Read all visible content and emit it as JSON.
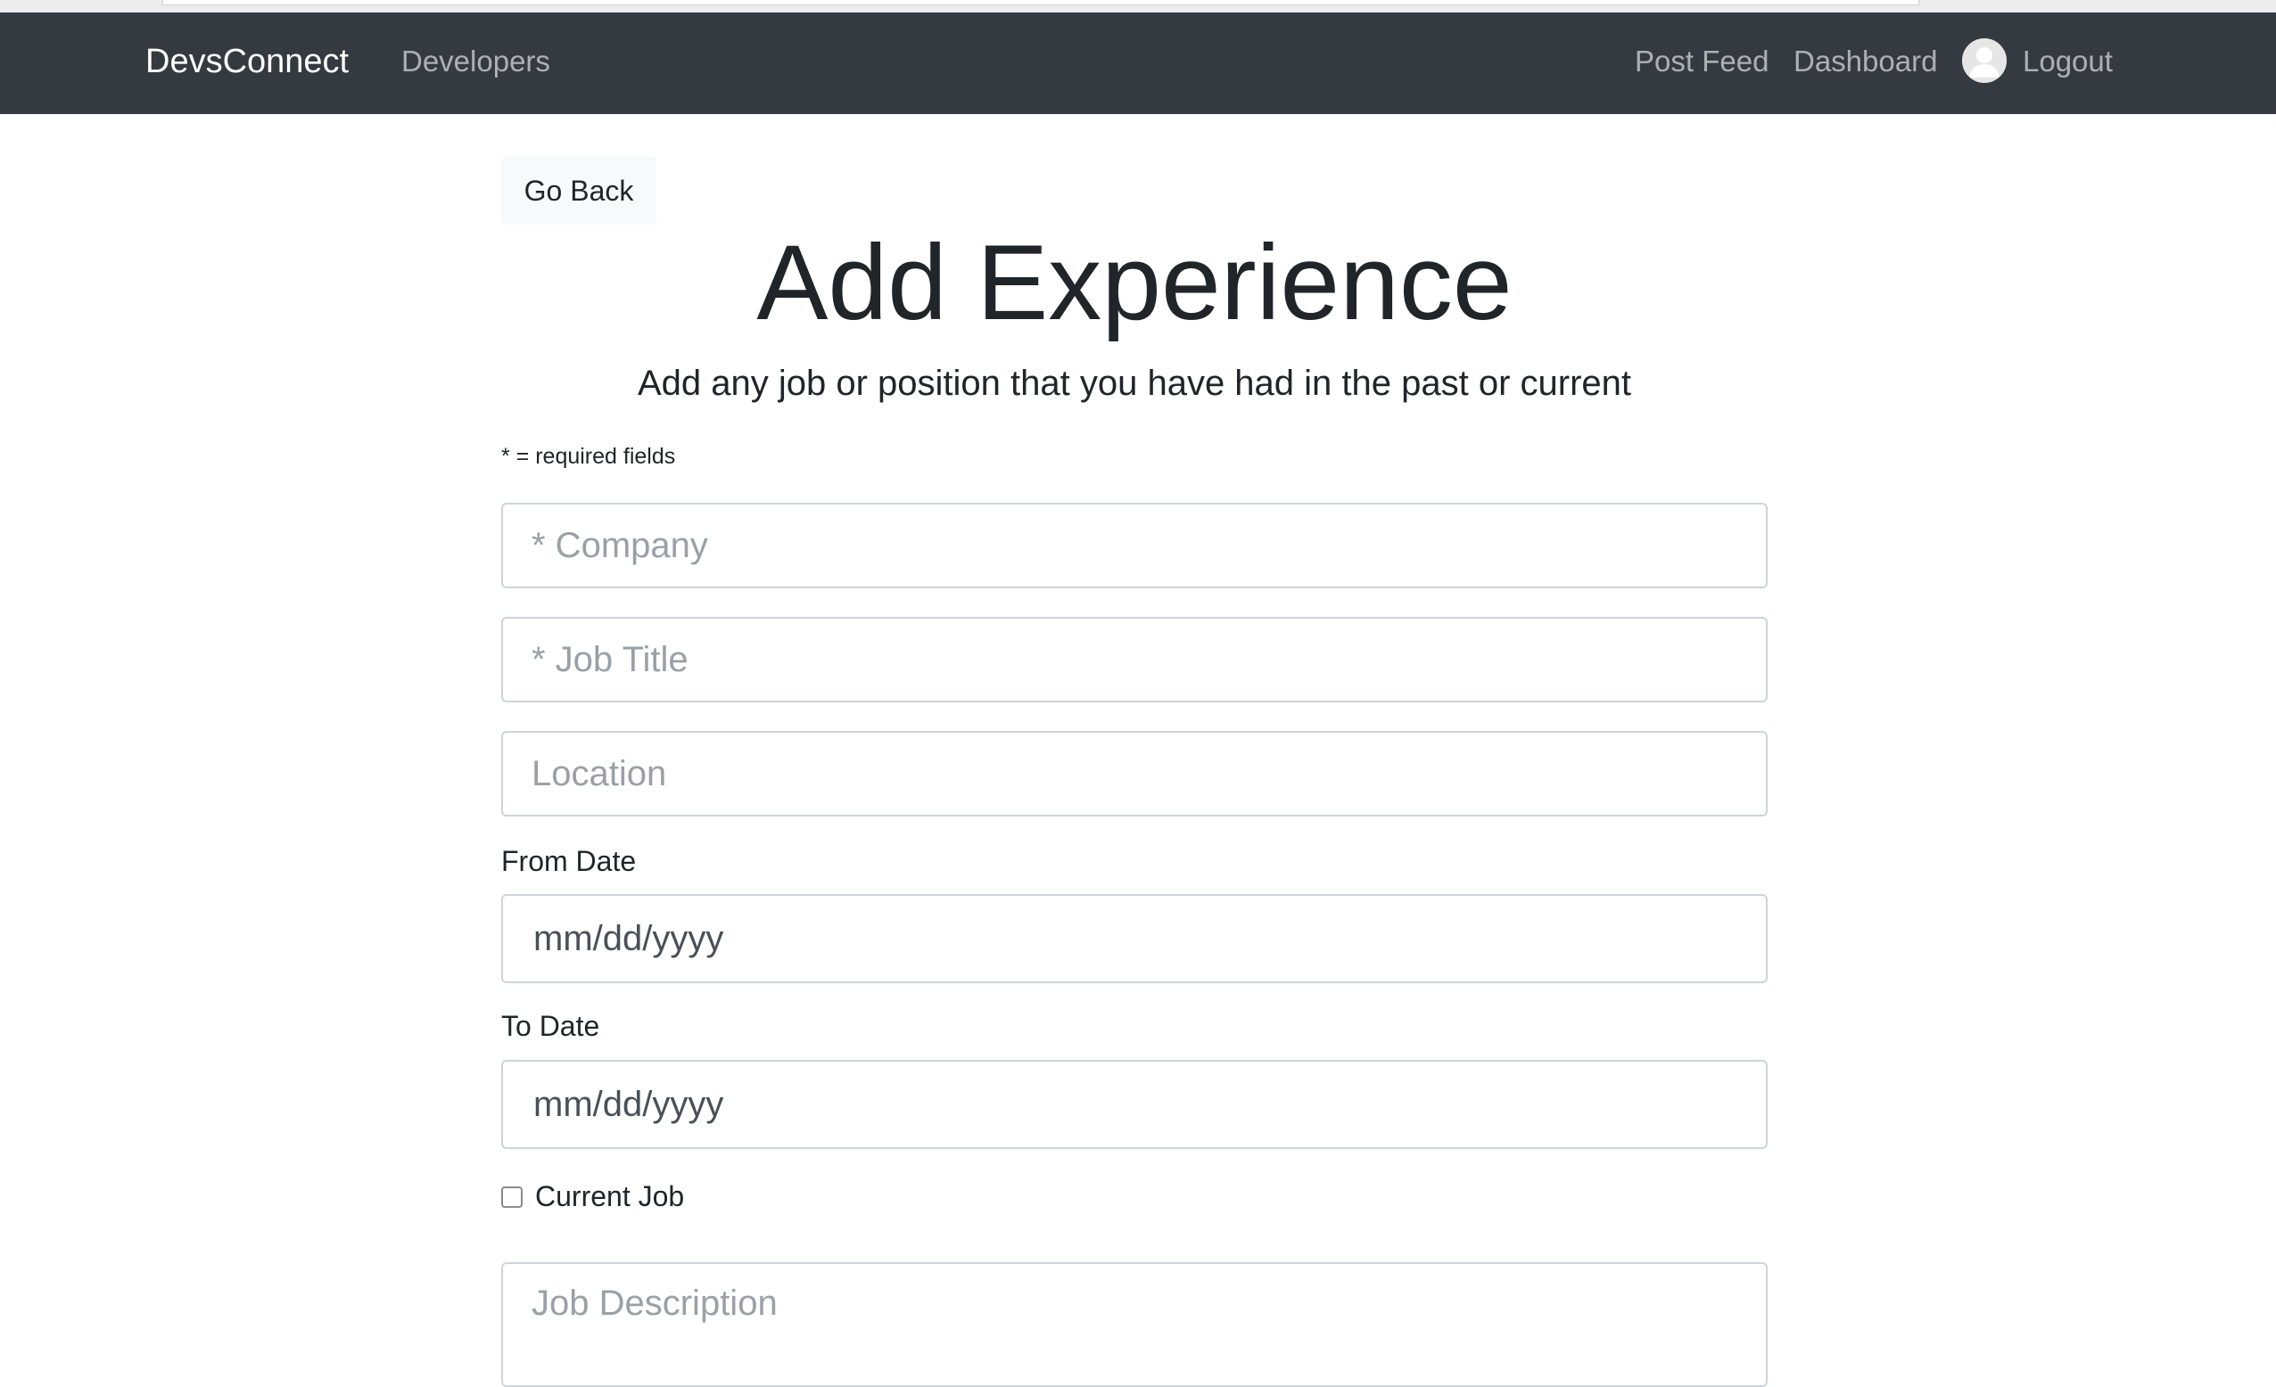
{
  "navbar": {
    "brand": "DevsConnect",
    "developers": "Developers",
    "post_feed": "Post Feed",
    "dashboard": "Dashboard",
    "logout": "Logout",
    "avatar_icon": "user-avatar-icon",
    "background_color": "#343a40"
  },
  "page": {
    "back_button": "Go Back",
    "title": "Add Experience",
    "lead": "Add any job or position that you have had in the past or current",
    "required_note": "* = required fields"
  },
  "form": {
    "company_placeholder": "* Company",
    "job_title_placeholder": "* Job Title",
    "location_placeholder": "Location",
    "from_date_label": "From Date",
    "from_date_value": "mm/dd/yyyy",
    "to_date_label": "To Date",
    "to_date_value": "mm/dd/yyyy",
    "current_job_label": "Current Job",
    "current_job_checked": false,
    "description_placeholder": "Job Description"
  }
}
